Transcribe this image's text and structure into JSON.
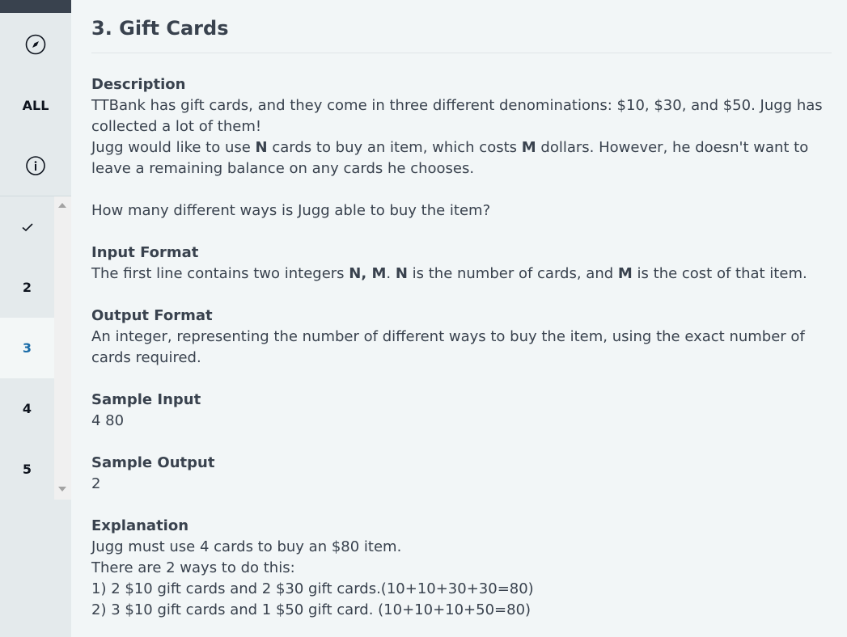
{
  "sidebar": {
    "all_label": "ALL",
    "questions": [
      "2",
      "3",
      "4",
      "5"
    ],
    "active_question": "3"
  },
  "problem": {
    "title": "3. Gift Cards",
    "description_heading": "Description",
    "desc_line1": "TTBank has gift cards, and they come in three different denominations: $10, $30, and $50.  Jugg has collected a lot of them!",
    "desc_line2_a": "Jugg would like to use ",
    "desc_line2_n": "N",
    "desc_line2_b": " cards to buy an item, which costs ",
    "desc_line2_m": "M",
    "desc_line2_c": " dollars. However, he doesn't want to leave a remaining balance on any cards he chooses.",
    "question": "How many different ways is Jugg able to buy the item?",
    "input_heading": "Input Format",
    "input_a": "The first line contains two integers ",
    "input_nm": "N, M",
    "input_b": ". ",
    "input_n": "N",
    "input_c": " is the number of cards, and ",
    "input_m": "M",
    "input_d": " is the cost of that item.",
    "output_heading": "Output Format",
    "output_text": "An integer, representing the number of different ways to buy the item, using the exact number of cards required.",
    "sample_input_heading": "Sample Input",
    "sample_input": "4 80",
    "sample_output_heading": "Sample Output",
    "sample_output": "2",
    "explanation_heading": "Explanation",
    "explanation_lines": [
      "Jugg must use 4 cards to buy an $80 item.",
      "There are 2 ways to do this:",
      "1) 2 $10 gift cards and 2 $30 gift cards.(10+10+30+30=80)",
      "2) 3 $10 gift cards and 1 $50 gift card. (10+10+10+50=80)"
    ]
  },
  "icons": {
    "compass": "compass-icon",
    "info": "info-icon",
    "check": "check-icon"
  },
  "colors": {
    "sidebar_bg": "#e4eaec",
    "main_bg": "#f2f6f7",
    "active_text": "#1a6ca8",
    "text": "#39424e"
  }
}
